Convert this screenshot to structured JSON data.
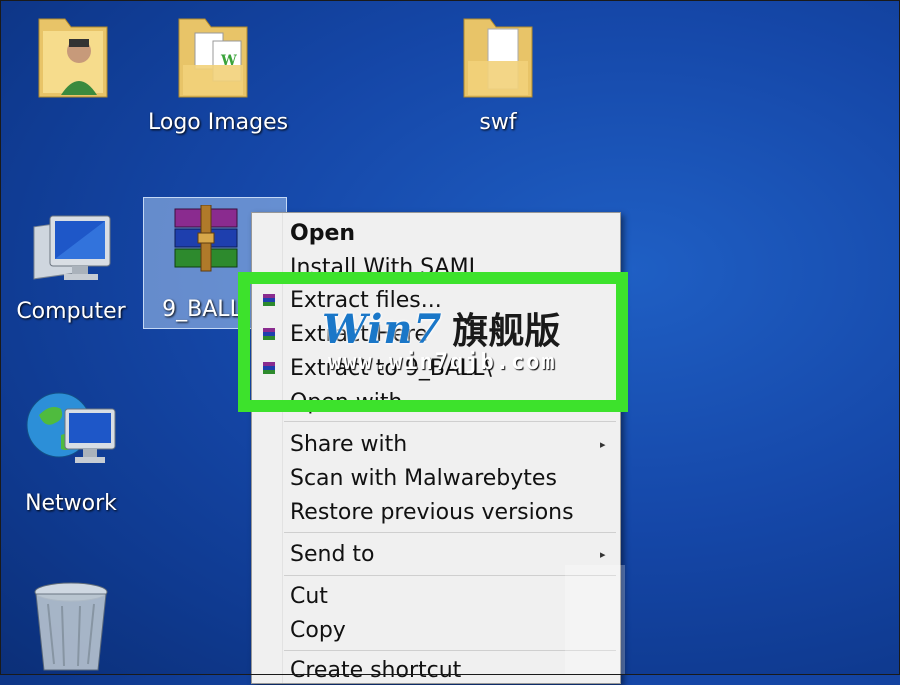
{
  "desktop": {
    "icons": [
      {
        "label": ""
      },
      {
        "label": "Logo Images"
      },
      {
        "label": "swf"
      },
      {
        "label": "Computer"
      },
      {
        "label": "9_BALL"
      },
      {
        "label": "Network"
      },
      {
        "label": ""
      }
    ]
  },
  "context_menu": {
    "items": [
      {
        "label": "Open"
      },
      {
        "label": "Install With SAMI"
      },
      {
        "label": "Extract files..."
      },
      {
        "label": "Extract Here"
      },
      {
        "label": "Extract to 9_BALL\\"
      },
      {
        "label": "Open with"
      },
      {
        "label": "Share with"
      },
      {
        "label": "Scan with Malwarebytes"
      },
      {
        "label": "Restore previous versions"
      },
      {
        "label": "Send to"
      },
      {
        "label": "Cut"
      },
      {
        "label": "Copy"
      },
      {
        "label": "Create shortcut"
      }
    ],
    "submenu_arrow": "▸"
  },
  "watermark": {
    "brand": "Win7",
    "chinese": "旗舰版",
    "url": "www.win7qjb.com"
  },
  "colors": {
    "highlight": "#3de22c",
    "desktop_blue": "#1547a8",
    "menu_bg": "#f0f0f0"
  }
}
